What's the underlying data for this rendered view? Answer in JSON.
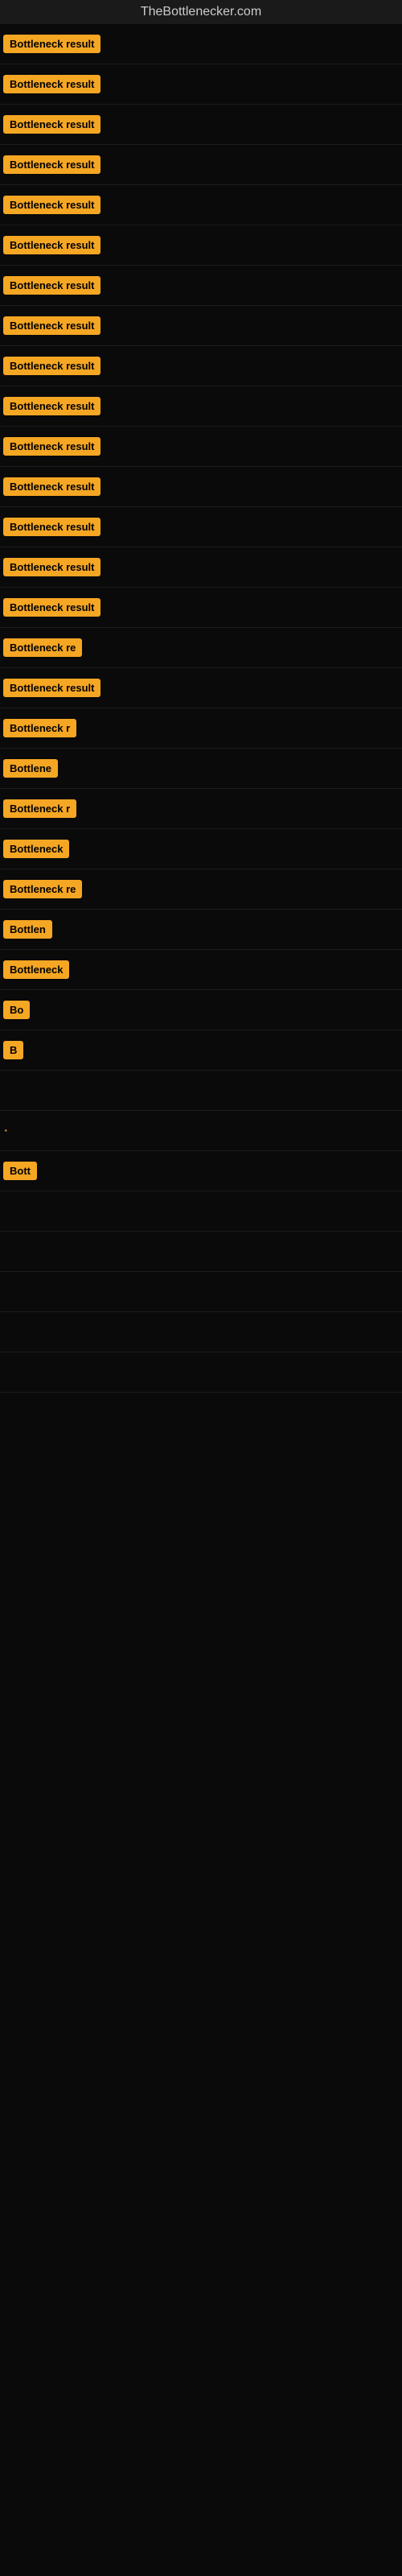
{
  "site": {
    "title": "TheBottlenecker.com"
  },
  "badges": [
    {
      "label": "Bottleneck result",
      "width": 130
    },
    {
      "label": "Bottleneck result",
      "width": 130
    },
    {
      "label": "Bottleneck result",
      "width": 130
    },
    {
      "label": "Bottleneck result",
      "width": 130
    },
    {
      "label": "Bottleneck result",
      "width": 130
    },
    {
      "label": "Bottleneck result",
      "width": 130
    },
    {
      "label": "Bottleneck result",
      "width": 130
    },
    {
      "label": "Bottleneck result",
      "width": 130
    },
    {
      "label": "Bottleneck result",
      "width": 130
    },
    {
      "label": "Bottleneck result",
      "width": 130
    },
    {
      "label": "Bottleneck result",
      "width": 130
    },
    {
      "label": "Bottleneck result",
      "width": 130
    },
    {
      "label": "Bottleneck result",
      "width": 130
    },
    {
      "label": "Bottleneck result",
      "width": 130
    },
    {
      "label": "Bottleneck result",
      "width": 130
    },
    {
      "label": "Bottleneck re",
      "width": 110
    },
    {
      "label": "Bottleneck result",
      "width": 120
    },
    {
      "label": "Bottleneck r",
      "width": 100
    },
    {
      "label": "Bottlene",
      "width": 80
    },
    {
      "label": "Bottleneck r",
      "width": 100
    },
    {
      "label": "Bottleneck",
      "width": 90
    },
    {
      "label": "Bottleneck re",
      "width": 105
    },
    {
      "label": "Bottlen",
      "width": 70
    },
    {
      "label": "Bottleneck",
      "width": 85
    },
    {
      "label": "Bo",
      "width": 30
    },
    {
      "label": "B",
      "width": 18
    },
    {
      "label": "",
      "width": 0
    },
    {
      "label": "·",
      "width": 14
    },
    {
      "label": "Bott",
      "width": 40
    },
    {
      "label": "",
      "width": 0
    },
    {
      "label": "",
      "width": 0
    },
    {
      "label": "",
      "width": 0
    },
    {
      "label": "",
      "width": 0
    },
    {
      "label": "",
      "width": 0
    }
  ]
}
